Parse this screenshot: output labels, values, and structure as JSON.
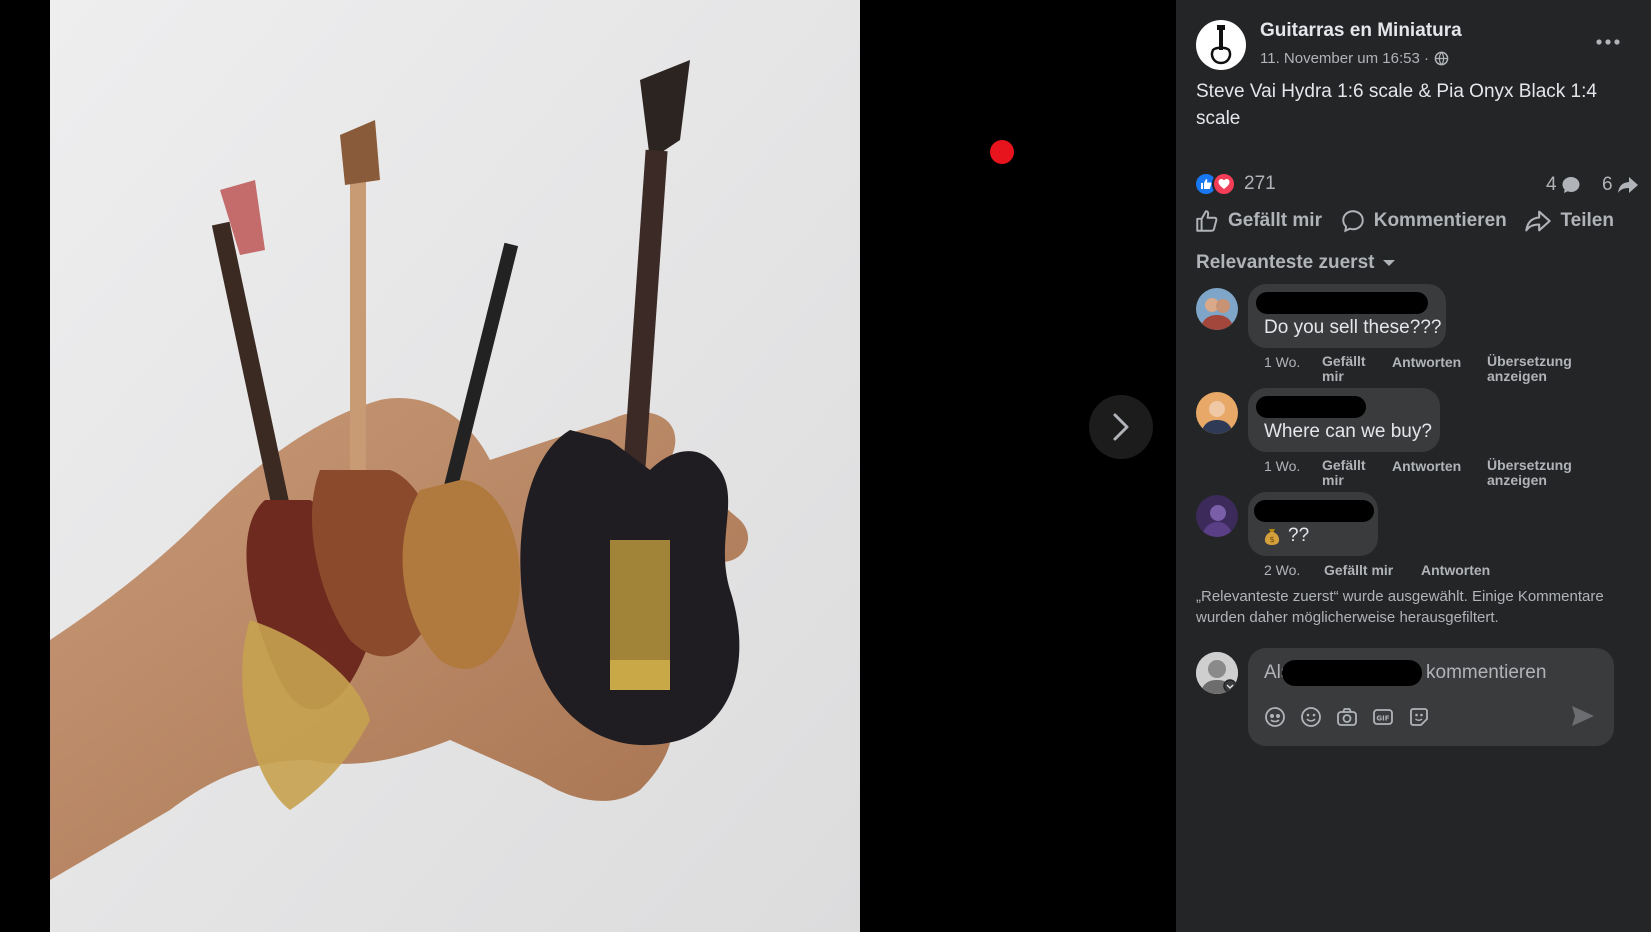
{
  "post": {
    "page_name": "Guitarras en Miniatura",
    "date": "11. November um 16:53 ·",
    "text": "Steve Vai Hydra 1:6 scale & Pia Onyx Black 1:4 scale",
    "reaction_count": "271",
    "comment_count": "4",
    "share_count": "6"
  },
  "actions": {
    "like": "Gefällt mir",
    "comment": "Kommentieren",
    "share": "Teilen"
  },
  "sort_label": "Relevanteste zuerst",
  "comments": [
    {
      "text": "Do you sell these???",
      "time": "1 Wo.",
      "like": "Gefällt mir",
      "reply": "Antworten",
      "translate": "Übersetzung anzeigen"
    },
    {
      "text": "Where can we buy?",
      "time": "1 Wo.",
      "like": "Gefällt mir",
      "reply": "Antworten",
      "translate": "Übersetzung anzeigen"
    },
    {
      "text": "??",
      "time": "2 Wo.",
      "like": "Gefällt mir",
      "reply": "Antworten"
    }
  ],
  "filter_notice": "„Relevanteste zuerst“ wurde ausgewählt. Einige Kommentare wurden daher möglicherweise herausgefiltert.",
  "composer": {
    "prefix": "Als",
    "suffix": "kommentieren"
  },
  "colors": {
    "panel": "#242526",
    "bubble": "#3a3b3c",
    "like_blue": "#1877f2",
    "love_red": "#f33e58",
    "secondary_text": "#b0b3b8"
  }
}
